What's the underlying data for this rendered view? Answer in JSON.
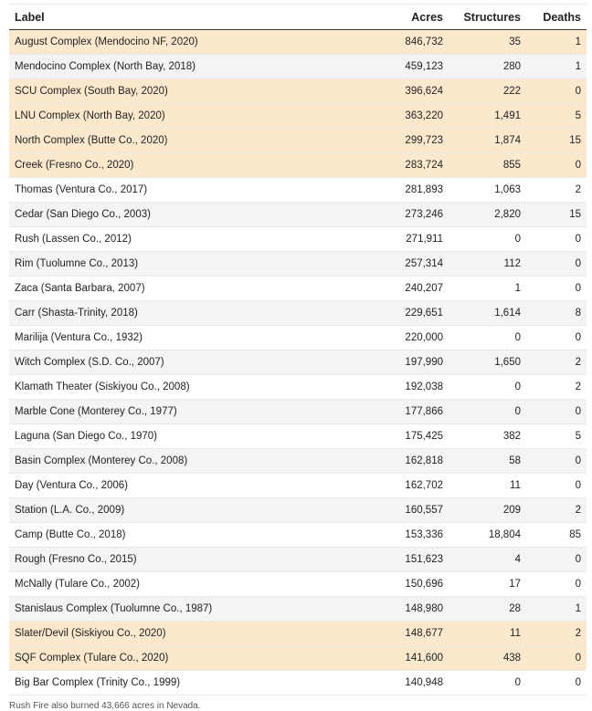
{
  "table": {
    "columns": [
      "Label",
      "Acres",
      "Structures",
      "Deaths"
    ],
    "rows": [
      {
        "label": "August Complex (Mendocino NF, 2020)",
        "acres": "846,732",
        "structures": "35",
        "deaths": "1",
        "highlight": true
      },
      {
        "label": "Mendocino Complex (North Bay, 2018)",
        "acres": "459,123",
        "structures": "280",
        "deaths": "1",
        "highlight": false
      },
      {
        "label": "SCU Complex (South Bay, 2020)",
        "acres": "396,624",
        "structures": "222",
        "deaths": "0",
        "highlight": true
      },
      {
        "label": "LNU Complex (North Bay, 2020)",
        "acres": "363,220",
        "structures": "1,491",
        "deaths": "5",
        "highlight": true
      },
      {
        "label": "North Complex (Butte Co., 2020)",
        "acres": "299,723",
        "structures": "1,874",
        "deaths": "15",
        "highlight": true
      },
      {
        "label": "Creek (Fresno Co., 2020)",
        "acres": "283,724",
        "structures": "855",
        "deaths": "0",
        "highlight": true
      },
      {
        "label": "Thomas (Ventura Co., 2017)",
        "acres": "281,893",
        "structures": "1,063",
        "deaths": "2",
        "highlight": false
      },
      {
        "label": "Cedar (San Diego Co., 2003)",
        "acres": "273,246",
        "structures": "2,820",
        "deaths": "15",
        "highlight": false
      },
      {
        "label": "Rush (Lassen Co., 2012)",
        "acres": "271,911",
        "structures": "0",
        "deaths": "0",
        "highlight": false
      },
      {
        "label": "Rim (Tuolumne Co., 2013)",
        "acres": "257,314",
        "structures": "112",
        "deaths": "0",
        "highlight": false
      },
      {
        "label": "Zaca (Santa Barbara, 2007)",
        "acres": "240,207",
        "structures": "1",
        "deaths": "0",
        "highlight": false
      },
      {
        "label": "Carr (Shasta-Trinity, 2018)",
        "acres": "229,651",
        "structures": "1,614",
        "deaths": "8",
        "highlight": false
      },
      {
        "label": "Marilija (Ventura Co., 1932)",
        "acres": "220,000",
        "structures": "0",
        "deaths": "0",
        "highlight": false
      },
      {
        "label": "Witch Complex (S.D. Co., 2007)",
        "acres": "197,990",
        "structures": "1,650",
        "deaths": "2",
        "highlight": false
      },
      {
        "label": "Klamath Theater (Siskiyou Co., 2008)",
        "acres": "192,038",
        "structures": "0",
        "deaths": "2",
        "highlight": false
      },
      {
        "label": "Marble Cone (Monterey Co., 1977)",
        "acres": "177,866",
        "structures": "0",
        "deaths": "0",
        "highlight": false
      },
      {
        "label": "Laguna (San Diego Co., 1970)",
        "acres": "175,425",
        "structures": "382",
        "deaths": "5",
        "highlight": false
      },
      {
        "label": "Basin Complex (Monterey Co., 2008)",
        "acres": "162,818",
        "structures": "58",
        "deaths": "0",
        "highlight": false
      },
      {
        "label": "Day (Ventura Co., 2006)",
        "acres": "162,702",
        "structures": "11",
        "deaths": "0",
        "highlight": false
      },
      {
        "label": "Station (L.A. Co., 2009)",
        "acres": "160,557",
        "structures": "209",
        "deaths": "2",
        "highlight": false
      },
      {
        "label": "Camp (Butte Co., 2018)",
        "acres": "153,336",
        "structures": "18,804",
        "deaths": "85",
        "highlight": false
      },
      {
        "label": "Rough (Fresno Co., 2015)",
        "acres": "151,623",
        "structures": "4",
        "deaths": "0",
        "highlight": false
      },
      {
        "label": "McNally (Tulare Co., 2002)",
        "acres": "150,696",
        "structures": "17",
        "deaths": "0",
        "highlight": false
      },
      {
        "label": "Stanislaus Complex (Tuolumne Co., 1987)",
        "acres": "148,980",
        "structures": "28",
        "deaths": "1",
        "highlight": false
      },
      {
        "label": "Slater/Devil (Siskiyou Co., 2020)",
        "acres": "148,677",
        "structures": "11",
        "deaths": "2",
        "highlight": true
      },
      {
        "label": "SQF Complex (Tulare Co., 2020)",
        "acres": "141,600",
        "structures": "438",
        "deaths": "0",
        "highlight": true
      },
      {
        "label": "Big Bar Complex (Trinity Co., 1999)",
        "acres": "140,948",
        "structures": "0",
        "deaths": "0",
        "highlight": false
      }
    ]
  },
  "footnote": "Rush Fire also burned 43,666 acres in Nevada.",
  "colors": {
    "highlight_row": "#fce8cd",
    "alt_row": "#f4f4f4",
    "header_rule": "#333333"
  }
}
